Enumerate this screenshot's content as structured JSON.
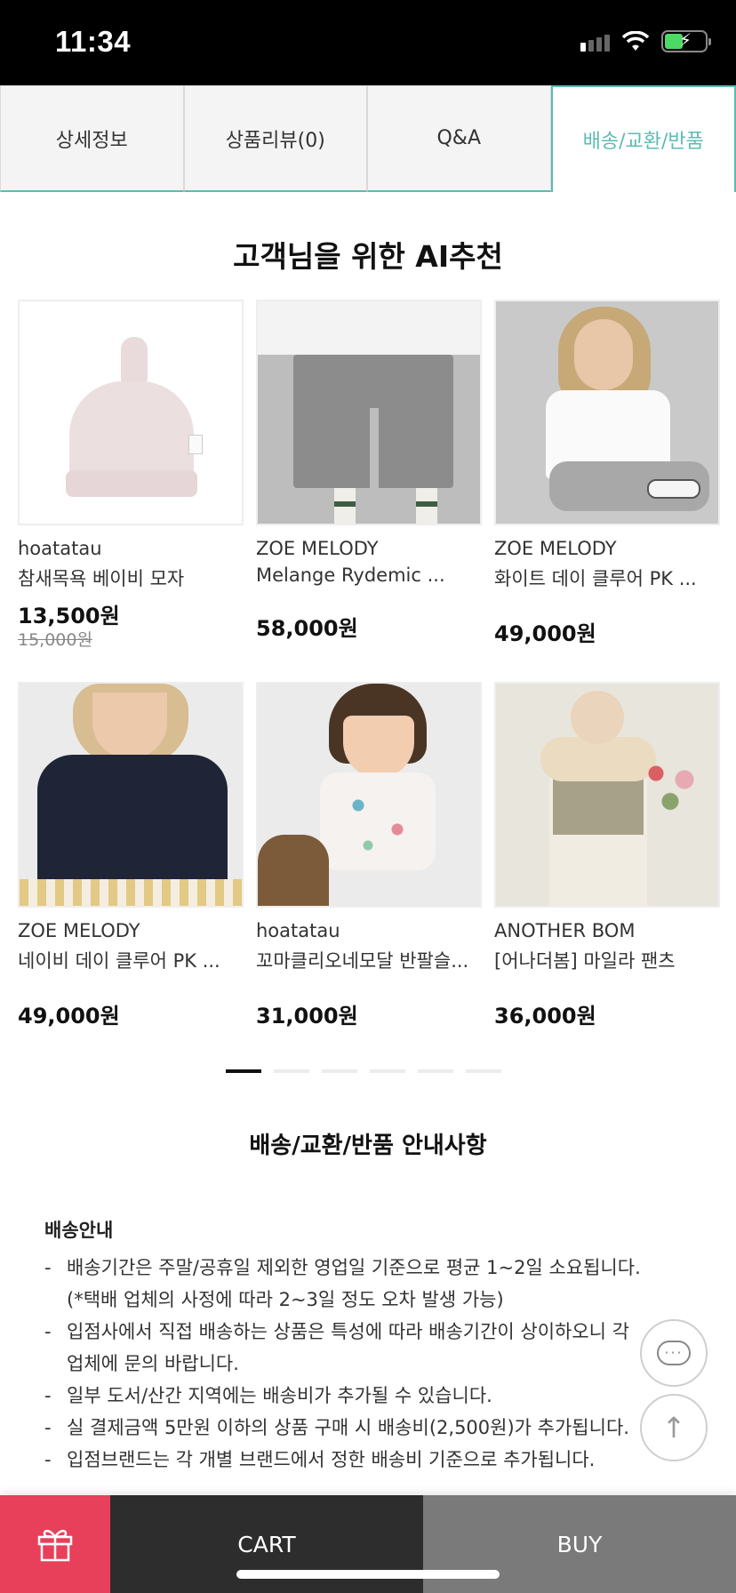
{
  "status_bar": {
    "time": "11:34"
  },
  "tabs": [
    {
      "label": "상세정보"
    },
    {
      "label": "상품리뷰(0)"
    },
    {
      "label": "Q&A"
    },
    {
      "label": "배송/교환/반품"
    }
  ],
  "recommend": {
    "title": "고객님을 위한 AI추천",
    "products": [
      {
        "brand": "hoatatau",
        "name": "참새목욕 베이비 모자",
        "price": "13,500원",
        "original_price": "15,000원"
      },
      {
        "brand": "ZOE MELODY",
        "name": "Melange Rydemic ...",
        "price": "58,000원",
        "original_price": ""
      },
      {
        "brand": "ZOE MELODY",
        "name": "화이트 데이 클루어 PK ...",
        "price": "49,000원",
        "original_price": ""
      },
      {
        "brand": "ZOE MELODY",
        "name": "네이비 데이 클루어 PK ...",
        "price": "49,000원",
        "original_price": ""
      },
      {
        "brand": "hoatatau",
        "name": "꼬마클리오네모달 반팔슬...",
        "price": "31,000원",
        "original_price": ""
      },
      {
        "brand": "ANOTHER BOM",
        "name": "[어나더봄] 마일라 팬츠",
        "price": "36,000원",
        "original_price": ""
      }
    ],
    "pager": {
      "pages": 6,
      "current": 1
    }
  },
  "shipping": {
    "title": "배송/교환/반품 안내사항",
    "heading": "배송안내",
    "items": [
      {
        "line1": "배송기간은 주말/공휴일 제외한 영업일 기준으로 평균 1~2일 소요됩니다.",
        "line2": "(*택배 업체의 사정에 따라 2~3일 정도 오차 발생 가능)"
      },
      {
        "line1": "입점사에서 직접 배송하는 상품은 특성에 따라 배송기간이 상이하오니 각",
        "line2": "업체에 문의 바랍니다."
      },
      {
        "line1": "일부 도서/산간 지역에는 배송비가 추가될 수 있습니다.",
        "line2": ""
      },
      {
        "line1": "실 결제금액 5만원 이하의 상품 구매 시 배송비(2,500원)가 추가됩니다.",
        "line2": ""
      },
      {
        "line1": "입점브랜드는 각 개별 브랜드에서 정한 배송비 기준으로 추가됩니다.",
        "line2": ""
      }
    ]
  },
  "bottom_bar": {
    "cart_label": "CART",
    "buy_label": "BUY"
  },
  "colors": {
    "accent": "#5bbcb3",
    "gift": "#e8405a",
    "cart_bg": "#2d2d2d",
    "buy_bg": "#7a7a7a"
  }
}
